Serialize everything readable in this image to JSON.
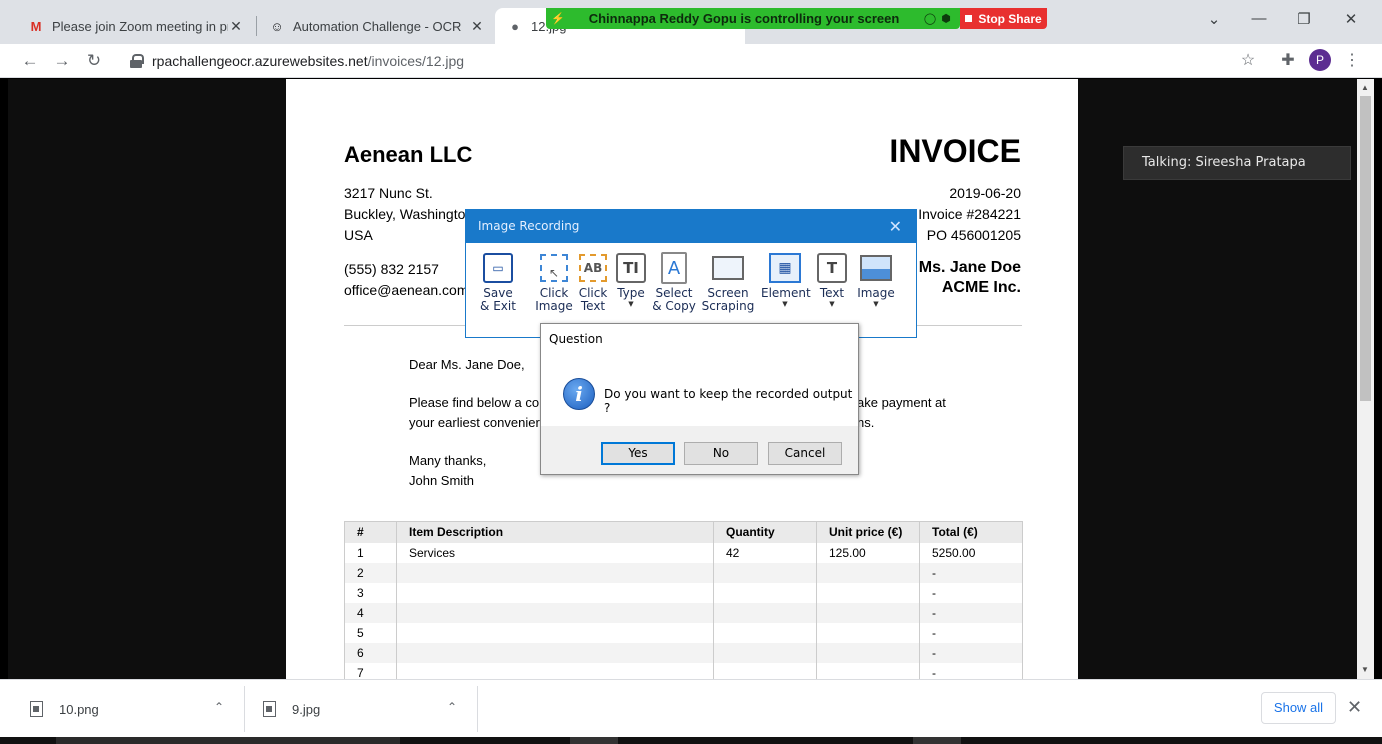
{
  "browser": {
    "tabs": [
      {
        "title": "Please join Zoom meeting in pro",
        "icon": "gmail-icon"
      },
      {
        "title": "Automation Challenge - OCR",
        "icon": "robot-icon"
      },
      {
        "title": "12.jpg",
        "icon": "globe-icon"
      }
    ],
    "url_host": "rpachallengeocr.azurewebsites.net",
    "url_path": "/invoices/12.jpg",
    "profile_initial": "P"
  },
  "zoom": {
    "banner": "Chinnappa Reddy Gopu is controlling your screen",
    "stop_share": "Stop Share",
    "talking": "Talking: Sireesha Pratapa"
  },
  "invoice": {
    "company": "Aenean LLC",
    "title": "INVOICE",
    "address": [
      "3217 Nunc St.",
      "Buckley, Washington",
      "USA"
    ],
    "meta": [
      "2019-06-20",
      "Invoice #284221",
      "PO 456001205"
    ],
    "contact": [
      "(555) 832 2157",
      "office@aenean.com"
    ],
    "client": [
      "Ms. Jane Doe",
      "ACME Inc."
    ],
    "greeting": "Dear Ms. Jane Doe,",
    "body_line1_start": "Please find below a co",
    "body_line1_end": "ake payment at",
    "body_line2_start": "your earliest convenier",
    "body_line2_end": "ns.",
    "closing1": "Many thanks,",
    "closing2": "John Smith",
    "table": {
      "headers": [
        "#",
        "Item Description",
        "Quantity",
        "Unit price (€)",
        "Total (€)"
      ],
      "rows": [
        [
          "1",
          "Services",
          "42",
          "125.00",
          "5250.00"
        ],
        [
          "2",
          "",
          "",
          "",
          "-"
        ],
        [
          "3",
          "",
          "",
          "",
          "-"
        ],
        [
          "4",
          "",
          "",
          "",
          "-"
        ],
        [
          "5",
          "",
          "",
          "",
          "-"
        ],
        [
          "6",
          "",
          "",
          "",
          "-"
        ],
        [
          "7",
          "",
          "",
          "",
          "-"
        ]
      ]
    }
  },
  "recorder": {
    "title": "Image Recording",
    "buttons": [
      {
        "line1": "Save",
        "line2": "& Exit"
      },
      {
        "line1": "Click",
        "line2": "Image"
      },
      {
        "line1": "Click",
        "line2": "Text"
      },
      {
        "line1": "Type",
        "line2": ""
      },
      {
        "line1": "Select",
        "line2": "& Copy"
      },
      {
        "line1": "Screen",
        "line2": "Scraping"
      },
      {
        "line1": "Element",
        "line2": ""
      },
      {
        "line1": "Text",
        "line2": ""
      },
      {
        "line1": "Image",
        "line2": ""
      }
    ]
  },
  "question": {
    "title": "Question",
    "message": "Do you want to keep the recorded output ?",
    "yes": "Yes",
    "no": "No",
    "cancel": "Cancel"
  },
  "downloads": {
    "items": [
      "10.png",
      "9.jpg"
    ],
    "show_all": "Show all"
  }
}
